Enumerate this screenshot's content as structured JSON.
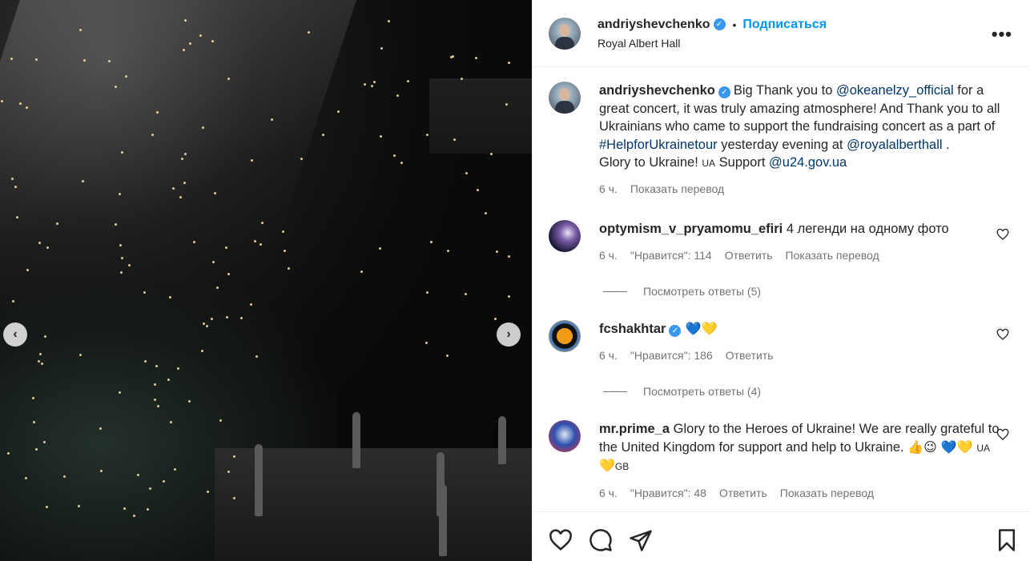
{
  "header": {
    "username": "andriyshevchenko",
    "verified": true,
    "separator": "•",
    "follow_label": "Подписаться",
    "location": "Royal Albert Hall",
    "more_label": "•••"
  },
  "media": {
    "prev_label": "‹",
    "next_label": "›"
  },
  "caption": {
    "username": "andriyshevchenko",
    "text_1": "Big Thank you to ",
    "mention_1": "@okeanelzy_official",
    "text_2": " for a great concert, it was truly amazing atmosphere! And Thank you to all Ukrainians who came to support the fundraising concert as a part of ",
    "hashtag": "#HelpforUkrainetour",
    "text_3": " yesterday evening at ",
    "mention_2": "@royalalberthall",
    "text_4": " .",
    "line2_text": "Glory to Ukraine! ",
    "flag_ua": "UA",
    "line2_support": " Support ",
    "mention_3": "@u24.gov.ua",
    "time": "6 ч.",
    "translate": "Показать перевод"
  },
  "comments": [
    {
      "username": "optymism_v_pryamomu_efiri",
      "text": " 4 легенди на одному фото",
      "time": "6 ч.",
      "likes": "\"Нравится\": 114",
      "reply": "Ответить",
      "translate": "Показать перевод",
      "view_replies": "Посмотреть ответы (5)"
    },
    {
      "username": "fcshakhtar",
      "verified": true,
      "text": " 💙💛",
      "time": "6 ч.",
      "likes": "\"Нравится\": 186",
      "reply": "Ответить",
      "view_replies": "Посмотреть ответы (4)"
    },
    {
      "username": "mr.prime_a",
      "text_1": " Glory to the Heroes of Ukraine! We are really grateful to the United Kingdom for support and help to Ukraine. ",
      "emoji_1": "👍😉 💙💛",
      "flag_ua": "UA",
      "emoji_2": "💛",
      "flag_gb": "GB",
      "time": "6 ч.",
      "likes": "\"Нравится\": 48",
      "reply": "Ответить",
      "translate": "Показать перевод"
    }
  ],
  "actions": {
    "like_icon": "heart-icon",
    "comment_icon": "comment-icon",
    "share_icon": "share-icon",
    "save_icon": "bookmark-icon"
  },
  "colors": {
    "link": "#00376b",
    "follow": "#0095f6",
    "muted": "#737373",
    "verified": "#3897f0"
  }
}
